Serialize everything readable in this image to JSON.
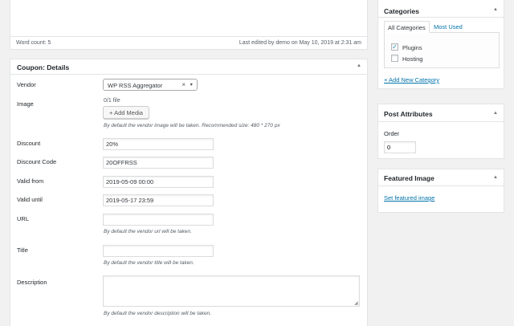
{
  "editor": {
    "word_count": "Word count: 5",
    "last_edited": "Last edited by demo on May 10, 2019 at 2:31 am"
  },
  "coupon": {
    "title": "Coupon: Details",
    "toggle_icon": "caret-up-icon",
    "fields": {
      "vendor": {
        "label": "Vendor",
        "value": "WP RSS Aggregator",
        "clear": "×",
        "arrow": "▼"
      },
      "image": {
        "label": "Image",
        "file_count": "0/1 file",
        "button": "+ Add Media",
        "help": "By default the vendor image will be taken. Recommended size: 480 * 270 px"
      },
      "discount": {
        "label": "Discount",
        "value": "20%"
      },
      "discount_code": {
        "label": "Discount Code",
        "value": "20OFFRSS"
      },
      "valid_from": {
        "label": "Valid from",
        "value": "2019-05-09 00:00"
      },
      "valid_until": {
        "label": "Valid until",
        "value": "2019-05-17 23:59"
      },
      "url": {
        "label": "URL",
        "value": "",
        "help": "By default the vendor url will be taken."
      },
      "title": {
        "label": "Title",
        "value": "",
        "help": "By default the vendor title will be taken."
      },
      "description": {
        "label": "Description",
        "value": "",
        "help": "By default the vendor description will be taken."
      }
    }
  },
  "categories": {
    "title": "Categories",
    "tabs": [
      "All Categories",
      "Most Used"
    ],
    "items": [
      {
        "label": "Plugins",
        "checked": true
      },
      {
        "label": "Hosting",
        "checked": false
      }
    ],
    "add_link": "+ Add New Category"
  },
  "post_attributes": {
    "title": "Post Attributes",
    "order_label": "Order",
    "order_value": "0"
  },
  "featured_image": {
    "title": "Featured Image",
    "link": "Set featured image"
  },
  "colors": {
    "link": "#0073aa",
    "background": "#f1f1f1",
    "border": "#e2e4e7"
  }
}
